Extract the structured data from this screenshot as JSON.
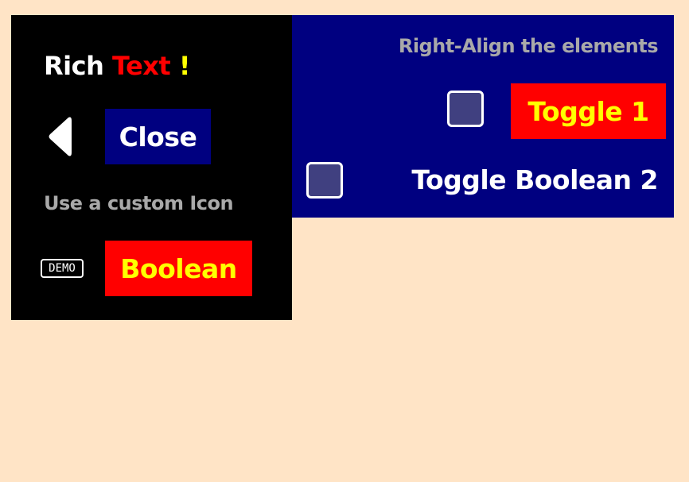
{
  "left_panel": {
    "rich_text": {
      "part_1": "Rich ",
      "part_2": "Text ",
      "part_3": "!"
    },
    "back_icon": "chevron-left-icon",
    "close_button_label": "Close",
    "custom_icon_label": "Use a custom Icon",
    "demo_icon_text": "DEMO",
    "boolean_toggle_label": "Boolean"
  },
  "right_panel": {
    "title": "Right-Align the elements",
    "toggle_1": {
      "label": "Toggle 1",
      "checked": false
    },
    "toggle_2": {
      "label": "Toggle Boolean 2",
      "checked": false
    }
  },
  "colors": {
    "background": "#ffe4c6",
    "left_panel_bg": "#000000",
    "right_panel_bg": "#000080",
    "accent_red": "#ff0000",
    "accent_yellow": "#ffff00",
    "muted_text": "#a9a9a9",
    "checkbox_fill": "#404080"
  }
}
